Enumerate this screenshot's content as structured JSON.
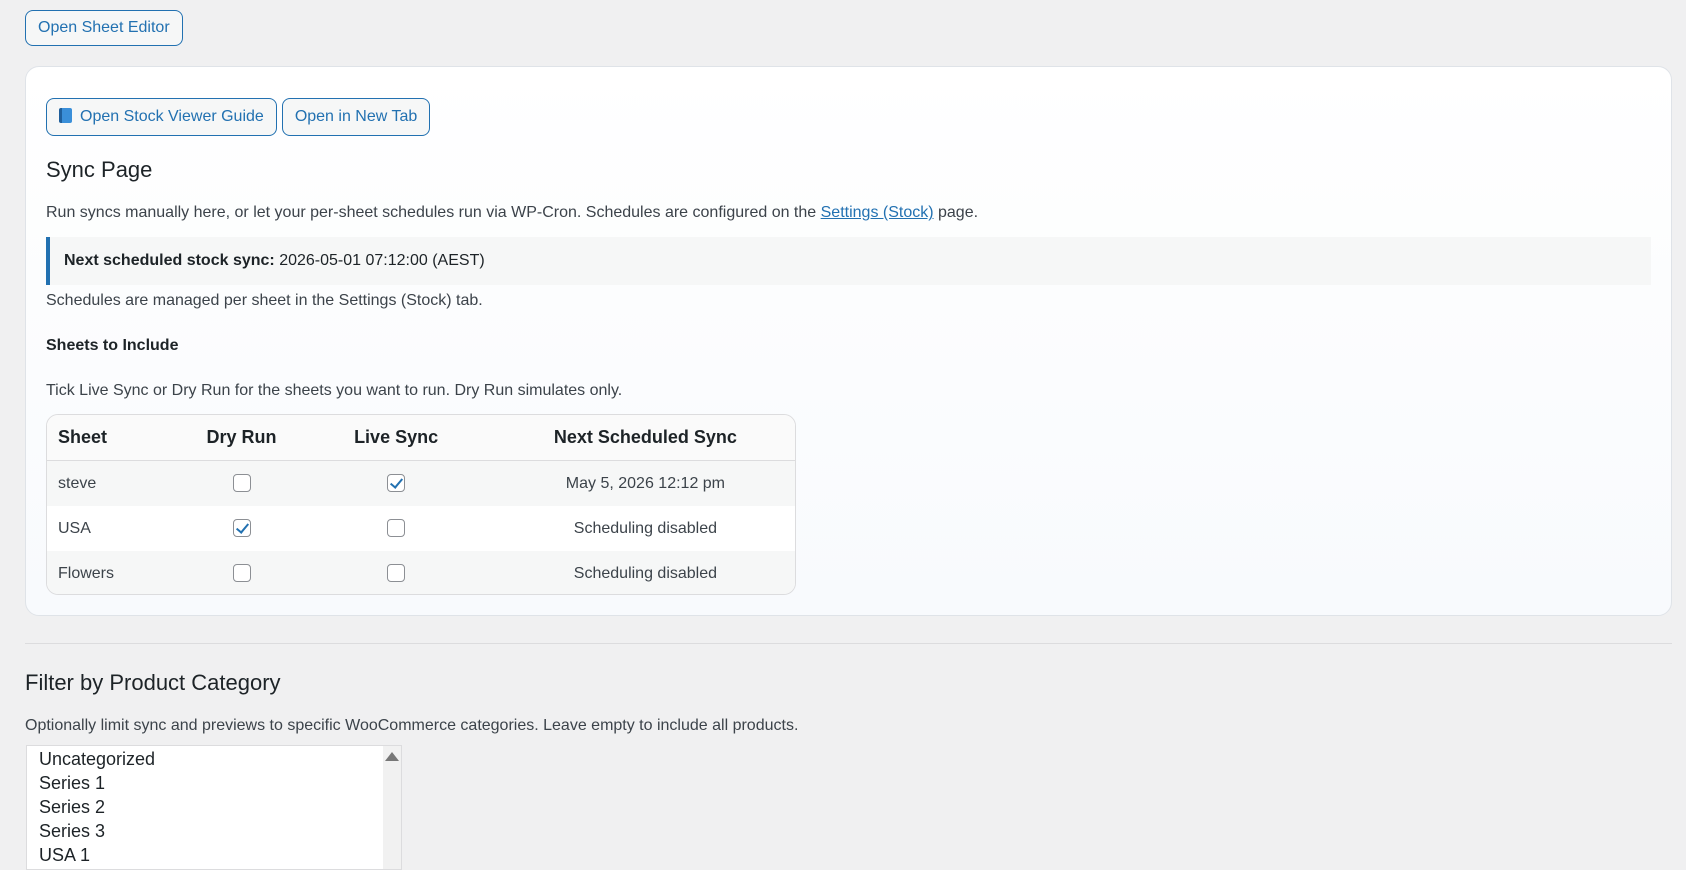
{
  "top": {
    "open_sheet_editor_label": "Open Sheet Editor"
  },
  "card": {
    "guide_button_label": "Open Stock Viewer Guide",
    "new_tab_button_label": "Open in New Tab",
    "title": "Sync Page",
    "description_prefix": "Run syncs manually here, or let your per-sheet schedules run via WP-Cron. Schedules are configured on the ",
    "settings_link_label": "Settings (Stock)",
    "description_suffix": " page.",
    "notice_label": "Next scheduled stock sync:",
    "notice_value": "2026-05-01 07:12:00 (AEST)",
    "schedules_note": "Schedules are managed per sheet in the Settings (Stock) tab.",
    "sheets_heading": "Sheets to Include",
    "tick_note": "Tick Live Sync or Dry Run for the sheets you want to run. Dry Run simulates only.",
    "table": {
      "headers": [
        "Sheet",
        "Dry Run",
        "Live Sync",
        "Next Scheduled Sync"
      ],
      "rows": [
        {
          "sheet": "steve",
          "dry_run": false,
          "live_sync": true,
          "next": "May 5, 2026 12:12 pm"
        },
        {
          "sheet": "USA",
          "dry_run": true,
          "live_sync": false,
          "next": "Scheduling disabled"
        },
        {
          "sheet": "Flowers",
          "dry_run": false,
          "live_sync": false,
          "next": "Scheduling disabled"
        }
      ]
    }
  },
  "filter": {
    "title": "Filter by Product Category",
    "description": "Optionally limit sync and previews to specific WooCommerce categories. Leave empty to include all products.",
    "categories": [
      "Uncategorized",
      "Series 1",
      "Series 2",
      "Series 3",
      "USA 1"
    ]
  },
  "icons": {
    "guide": "book-icon",
    "scroll": "scroll-up-arrow-icon"
  },
  "colors": {
    "accent": "#2271b1",
    "background": "#f0f0f1"
  }
}
